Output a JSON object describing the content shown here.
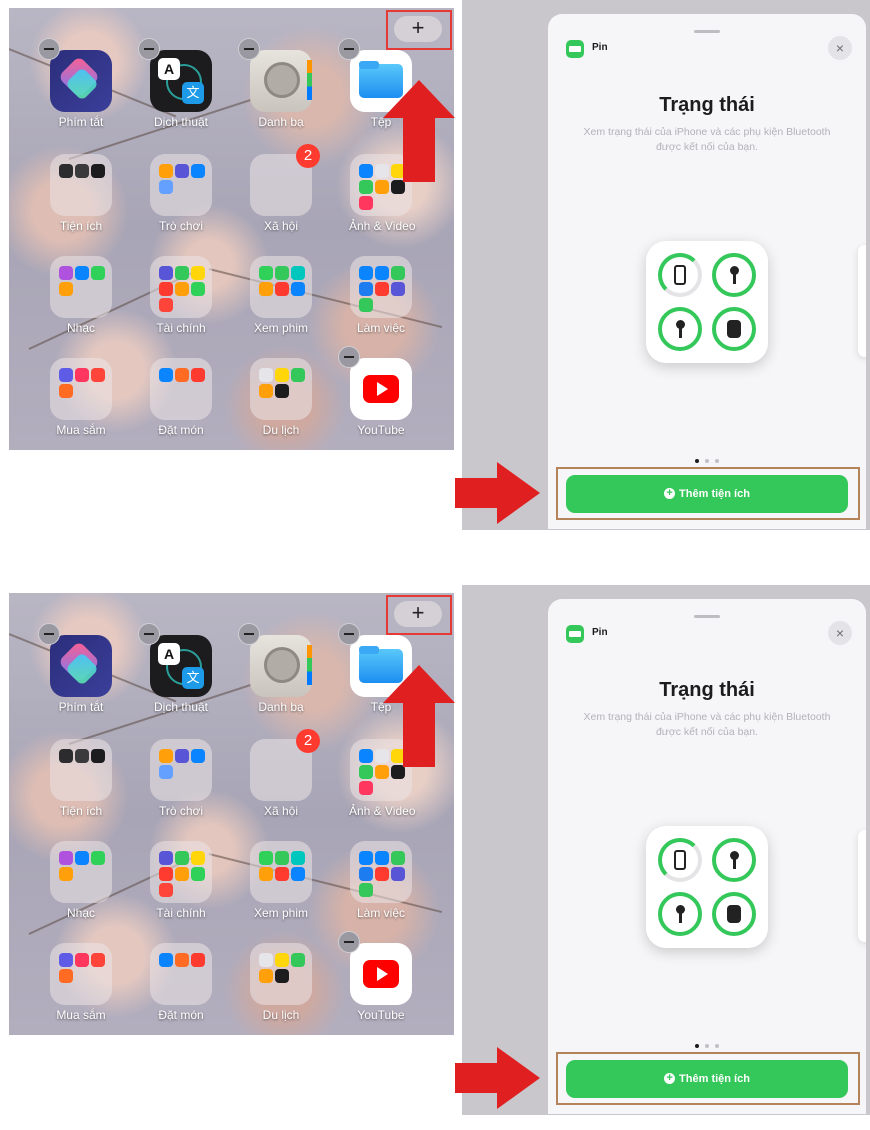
{
  "steps": [
    {
      "home": {
        "add_button": "+",
        "apps": [
          {
            "label": "Phím tắt"
          },
          {
            "label": "Dịch thuật"
          },
          {
            "label": "Danh bạ"
          },
          {
            "label": "Tệp"
          },
          {
            "label": "Tiện ích"
          },
          {
            "label": "Trò chơi"
          },
          {
            "label": "Xã hội",
            "badge": "2"
          },
          {
            "label": "Ảnh & Video"
          },
          {
            "label": "Nhạc"
          },
          {
            "label": "Tài chính"
          },
          {
            "label": "Xem phim"
          },
          {
            "label": "Làm việc"
          },
          {
            "label": "Mua sắm"
          },
          {
            "label": "Đặt món"
          },
          {
            "label": "Du lịch"
          },
          {
            "label": "YouTube"
          }
        ]
      },
      "sheet": {
        "app_name": "Pin",
        "close": "×",
        "title": "Trạng thái",
        "description": "Xem trạng thái của iPhone và các phụ kiện Bluetooth được kết nối của bạn.",
        "add_widget_label": "Thêm tiện ích"
      }
    },
    {
      "home": {
        "add_button": "+",
        "apps": [
          {
            "label": "Phím tắt"
          },
          {
            "label": "Dịch thuật"
          },
          {
            "label": "Danh bạ"
          },
          {
            "label": "Tệp"
          },
          {
            "label": "Tiện ích"
          },
          {
            "label": "Trò chơi"
          },
          {
            "label": "Xã hội",
            "badge": "2"
          },
          {
            "label": "Ảnh & Video"
          },
          {
            "label": "Nhạc"
          },
          {
            "label": "Tài chính"
          },
          {
            "label": "Xem phim"
          },
          {
            "label": "Làm việc"
          },
          {
            "label": "Mua sắm"
          },
          {
            "label": "Đặt món"
          },
          {
            "label": "Du lịch"
          },
          {
            "label": "YouTube"
          }
        ]
      },
      "sheet": {
        "app_name": "Pin",
        "close": "×",
        "title": "Trạng thái",
        "description": "Xem trạng thái của iPhone và các phụ kiện Bluetooth được kết nối của bạn.",
        "add_widget_label": "Thêm tiện ích"
      }
    }
  ],
  "colors": {
    "accent_green": "#34c759",
    "highlight_red": "#e53935",
    "arrow_red": "#e02020",
    "frame_brown": "#b5835a",
    "badge_red": "#ff3b30"
  },
  "icons": [
    "shortcuts-icon",
    "translate-icon",
    "contacts-icon",
    "files-icon",
    "folder-icon",
    "youtube-icon",
    "close-icon",
    "plus-icon",
    "battery-icon",
    "phone-icon",
    "airpod-icon",
    "airpods-case-icon"
  ]
}
